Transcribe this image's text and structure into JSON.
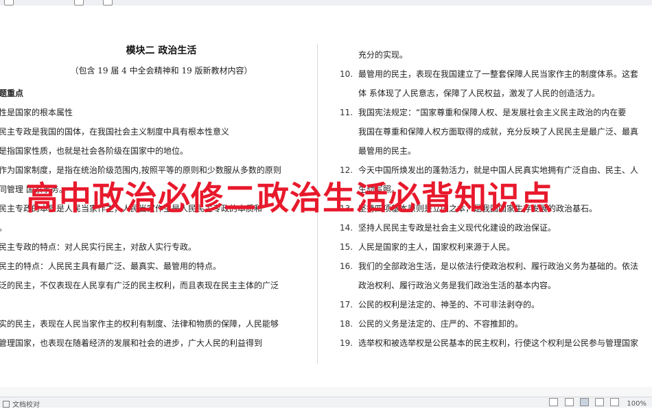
{
  "toolbar": {
    "items": [
      "",
      "",
      ""
    ]
  },
  "document": {
    "title": "模块二  政治生活",
    "subtitle": "（包含 19 届 4 中全会精神和 19 版新教材内容）",
    "left_lines": [
      {
        "text": "题重点",
        "bold": true
      },
      {
        "text": "性是国家的根本属性",
        "bold": false
      },
      {
        "text": "民主专政是我国的国体，在我国社会主义制度中具有根本性意义",
        "bold": false
      },
      {
        "text": "是指国家性质，也就是社会各阶级在国家中的地位。",
        "bold": false
      },
      {
        "text": "作为国家制度，是指在统治阶级范围内,按照平等的原则和少数服从多数的原则",
        "bold": false
      },
      {
        "text": "同管理  国家事务。",
        "bold": false
      },
      {
        "text": "民主专政的本质是人民当家作主，人民当家作主是人民民主专政的本质和",
        "bold": false
      },
      {
        "text": "。",
        "bold": false
      },
      {
        "text": "民主专政的特点：对人民实行民主，对敌人实行专政。",
        "bold": false
      },
      {
        "text": "民主的特点：人民民主具有最广泛、最真实、最管用的特点。",
        "bold": false
      },
      {
        "text": "泛的民主，不仅表现在人民享有广泛的民主权利，而且表现在民主主体的广泛",
        "bold": false
      },
      {
        "text": "",
        "bold": false
      },
      {
        "text": "实的民主，表现在人民当家作主的权利有制度、法律和物质的保障，人民能够",
        "bold": false
      },
      {
        "text": "管理国家，也表现在随着经济的发展和社会的进步，广大人民的利益得到",
        "bold": false
      }
    ],
    "right_lines": [
      {
        "num": "",
        "text": "充分的实现。"
      },
      {
        "num": "10.",
        "text": "最管用的民主，表现在我国建立了一整套保障人民当家作主的制度体系。这套"
      },
      {
        "num": "",
        "text": "体  系体现了人民意志，保障了人民权益，激发了人民的创造活力。"
      },
      {
        "num": "11.",
        "text": "我国宪法规定：“国家尊重和保障人权、是发展社会主义民主政治的内在要"
      },
      {
        "num": "",
        "text": "我国在尊重和保障人权方面取得的成就，充分反映了人民民主是最广泛、最真"
      },
      {
        "num": "",
        "text": "最管用的民主。"
      },
      {
        "num": "12.",
        "text": "今天中国所焕发出的蓬勃活力，就是中国人民真实地拥有广泛自由、民主、人"
      },
      {
        "num": "",
        "text": "生动写照。"
      },
      {
        "num": "13.",
        "text": "坚持四项基本原则是立国之本，是我国国家生存发展的政治基石。"
      },
      {
        "num": "14.",
        "text": "坚持人民民主专政是社会主义现代化建设的政治保证。"
      },
      {
        "num": "15.",
        "text": "人民是国家的主人，国家权利来源于人民。"
      },
      {
        "num": "16.",
        "text": "我们的全部政治生活，是以依法行使政治权利、履行政治义务为基础的。依法"
      },
      {
        "num": "",
        "text": "政治权利、履行政治义务是我们政治生活的基本内容。"
      },
      {
        "num": "17.",
        "text": "公民的权利是法定的、神圣的、不可非法剥夺的。"
      },
      {
        "num": "18.",
        "text": "公民的义务是法定的、庄严的、不容推卸的。"
      },
      {
        "num": "19.",
        "text": "选举权和被选举权是公民基本的民主权利，行使这个权利是公民参与管理国家"
      }
    ]
  },
  "overlay": {
    "text": "高中政治必修二政治生活必背知识点",
    "color": "#e8192c"
  },
  "statusbar": {
    "left_label": "文档校对",
    "zoom": "100%"
  }
}
